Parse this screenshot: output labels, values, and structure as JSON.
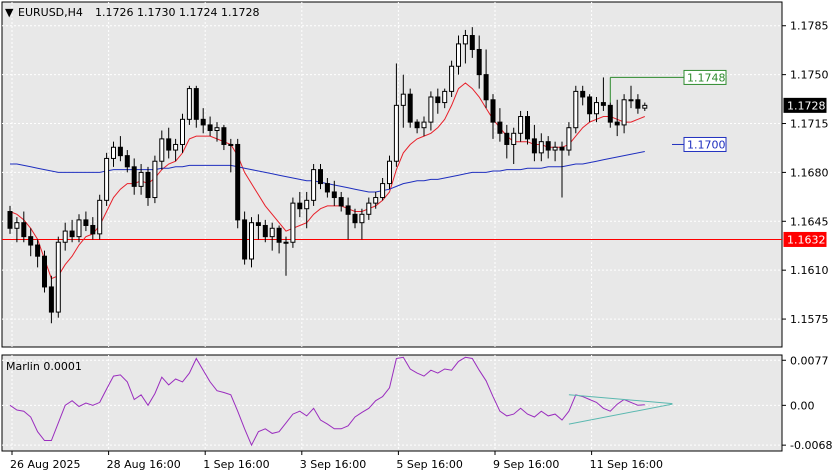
{
  "header": {
    "symbol": "EURUSD,H4",
    "ohlc": "1.1726 1.1730 1.1724 1.1728"
  },
  "colors": {
    "background": "#e8e8e8",
    "grid": "#ffffff",
    "candle_up_fill": "#ffffff",
    "candle_down_fill": "#000000",
    "candle_outline": "#000000",
    "ma_fast": "#e8202a",
    "ma_slow": "#1f2fbf",
    "support_line": "#ff0000",
    "label_green": "#2e8b2e",
    "label_blue": "#1f2fbf",
    "oscillator": "#9a2dbe",
    "trendline": "#5bb8b0"
  },
  "chart_data": [
    {
      "type": "candlestick",
      "title": "EURUSD,H4",
      "ylim": [
        1.1555,
        1.1802
      ],
      "y_ticks": [
        "1.1785",
        "1.1750",
        "1.1715",
        "1.1680",
        "1.1645",
        "1.1610",
        "1.1575"
      ],
      "x_ticks": [
        "26 Aug 2025",
        "28 Aug 16:00",
        "1 Sep 16:00",
        "3 Sep 16:00",
        "5 Sep 16:00",
        "9 Sep 16:00",
        "11 Sep 16:00"
      ],
      "grid": true,
      "ohlc": [
        [
          1.1652,
          1.1656,
          1.1636,
          1.164
        ],
        [
          1.164,
          1.1648,
          1.163,
          1.1644
        ],
        [
          1.1644,
          1.1652,
          1.163,
          1.1634
        ],
        [
          1.1634,
          1.164,
          1.162,
          1.1628
        ],
        [
          1.1628,
          1.1632,
          1.1612,
          1.162
        ],
        [
          1.162,
          1.1624,
          1.1594,
          1.1598
        ],
        [
          1.1598,
          1.1606,
          1.1572,
          1.158
        ],
        [
          1.158,
          1.1634,
          1.1576,
          1.163
        ],
        [
          1.163,
          1.1644,
          1.1624,
          1.1638
        ],
        [
          1.1638,
          1.1646,
          1.163,
          1.1634
        ],
        [
          1.1634,
          1.165,
          1.163,
          1.1646
        ],
        [
          1.1646,
          1.1652,
          1.1638,
          1.1642
        ],
        [
          1.1642,
          1.1648,
          1.1632,
          1.1636
        ],
        [
          1.1636,
          1.1664,
          1.1632,
          1.166
        ],
        [
          1.166,
          1.1694,
          1.1656,
          1.169
        ],
        [
          1.169,
          1.1702,
          1.1684,
          1.1698
        ],
        [
          1.1698,
          1.1706,
          1.1688,
          1.1692
        ],
        [
          1.1692,
          1.1696,
          1.168,
          1.1684
        ],
        [
          1.1684,
          1.169,
          1.1664,
          1.167
        ],
        [
          1.167,
          1.1686,
          1.1664,
          1.168
        ],
        [
          1.168,
          1.1684,
          1.1656,
          1.1662
        ],
        [
          1.1662,
          1.1692,
          1.1658,
          1.1688
        ],
        [
          1.1688,
          1.171,
          1.1682,
          1.1704
        ],
        [
          1.1704,
          1.1712,
          1.169,
          1.1696
        ],
        [
          1.1696,
          1.1704,
          1.1688,
          1.17
        ],
        [
          1.17,
          1.1722,
          1.1694,
          1.1718
        ],
        [
          1.1718,
          1.1742,
          1.1714,
          1.174
        ],
        [
          1.174,
          1.1742,
          1.1712,
          1.1718
        ],
        [
          1.1718,
          1.1726,
          1.1708,
          1.1714
        ],
        [
          1.1714,
          1.172,
          1.1706,
          1.171
        ],
        [
          1.171,
          1.1716,
          1.1702,
          1.1712
        ],
        [
          1.1712,
          1.1714,
          1.1696,
          1.17
        ],
        [
          1.17,
          1.1704,
          1.168,
          1.17
        ],
        [
          1.17,
          1.1704,
          1.164,
          1.1646
        ],
        [
          1.1646,
          1.1652,
          1.1614,
          1.1618
        ],
        [
          1.1618,
          1.1648,
          1.1612,
          1.1644
        ],
        [
          1.1644,
          1.165,
          1.1632,
          1.1642
        ],
        [
          1.1642,
          1.1646,
          1.163,
          1.1634
        ],
        [
          1.1634,
          1.1644,
          1.1624,
          1.164
        ],
        [
          1.164,
          1.1642,
          1.1622,
          1.163
        ],
        [
          1.163,
          1.1634,
          1.1606,
          1.163
        ],
        [
          1.163,
          1.1662,
          1.1626,
          1.1658
        ],
        [
          1.1658,
          1.1666,
          1.1648,
          1.1654
        ],
        [
          1.1654,
          1.1666,
          1.164,
          1.166
        ],
        [
          1.166,
          1.1686,
          1.1656,
          1.1682
        ],
        [
          1.1682,
          1.1686,
          1.1668,
          1.1672
        ],
        [
          1.1672,
          1.1676,
          1.1662,
          1.1666
        ],
        [
          1.1666,
          1.1674,
          1.1656,
          1.1662
        ],
        [
          1.1662,
          1.1666,
          1.1652,
          1.1656
        ],
        [
          1.1656,
          1.1662,
          1.1632,
          1.165
        ],
        [
          1.165,
          1.1654,
          1.164,
          1.1644
        ],
        [
          1.1644,
          1.1654,
          1.1632,
          1.165
        ],
        [
          1.165,
          1.1662,
          1.1646,
          1.1658
        ],
        [
          1.1658,
          1.1666,
          1.1654,
          1.1662
        ],
        [
          1.1662,
          1.1676,
          1.166,
          1.1672
        ],
        [
          1.1672,
          1.1692,
          1.1668,
          1.1688
        ],
        [
          1.1688,
          1.1758,
          1.1684,
          1.1728
        ],
        [
          1.1728,
          1.175,
          1.1712,
          1.1736
        ],
        [
          1.1736,
          1.174,
          1.1712,
          1.1716
        ],
        [
          1.1716,
          1.1718,
          1.1708,
          1.1712
        ],
        [
          1.1712,
          1.172,
          1.1706,
          1.1716
        ],
        [
          1.1716,
          1.1738,
          1.171,
          1.1734
        ],
        [
          1.1734,
          1.174,
          1.1722,
          1.173
        ],
        [
          1.173,
          1.174,
          1.1726,
          1.1738
        ],
        [
          1.1738,
          1.176,
          1.1734,
          1.1756
        ],
        [
          1.1756,
          1.1778,
          1.175,
          1.1772
        ],
        [
          1.1772,
          1.1782,
          1.1758,
          1.1778
        ],
        [
          1.1778,
          1.1784,
          1.1762,
          1.1768
        ],
        [
          1.1768,
          1.1778,
          1.174,
          1.175
        ],
        [
          1.175,
          1.1768,
          1.1726,
          1.1732
        ],
        [
          1.1732,
          1.1736,
          1.1704,
          1.1716
        ],
        [
          1.1716,
          1.1726,
          1.1702,
          1.1708
        ],
        [
          1.1708,
          1.1714,
          1.169,
          1.17
        ],
        [
          1.17,
          1.1712,
          1.1686,
          1.1708
        ],
        [
          1.1708,
          1.1724,
          1.1702,
          1.172
        ],
        [
          1.172,
          1.1724,
          1.17,
          1.1704
        ],
        [
          1.1704,
          1.1714,
          1.1688,
          1.1694
        ],
        [
          1.1694,
          1.1708,
          1.1688,
          1.1702
        ],
        [
          1.1702,
          1.1706,
          1.169,
          1.1696
        ],
        [
          1.1696,
          1.1702,
          1.1688,
          1.1698
        ],
        [
          1.1698,
          1.1702,
          1.1662,
          1.1696
        ],
        [
          1.1696,
          1.1716,
          1.1692,
          1.1712
        ],
        [
          1.1712,
          1.1742,
          1.1708,
          1.1738
        ],
        [
          1.1738,
          1.1742,
          1.1728,
          1.1734
        ],
        [
          1.1734,
          1.1736,
          1.1716,
          1.1722
        ],
        [
          1.1722,
          1.1734,
          1.1716,
          1.173
        ],
        [
          1.173,
          1.1748,
          1.1724,
          1.1728
        ],
        [
          1.1728,
          1.173,
          1.1712,
          1.1716
        ],
        [
          1.1716,
          1.1732,
          1.1706,
          1.1714
        ],
        [
          1.1714,
          1.1736,
          1.1708,
          1.1732
        ],
        [
          1.1732,
          1.1742,
          1.1726,
          1.1732
        ],
        [
          1.1732,
          1.1736,
          1.1722,
          1.1726
        ],
        [
          1.1726,
          1.173,
          1.1724,
          1.1728
        ]
      ],
      "series": [
        {
          "kind": "ma_fast",
          "values": [
            1.1652,
            1.165,
            1.1646,
            1.164,
            1.1632,
            1.1618,
            1.1604,
            1.1606,
            1.1614,
            1.162,
            1.1628,
            1.1634,
            1.1636,
            1.1642,
            1.1652,
            1.1662,
            1.1668,
            1.1672,
            1.1672,
            1.1674,
            1.1672,
            1.1676,
            1.1682,
            1.1686,
            1.1688,
            1.1694,
            1.1704,
            1.1706,
            1.1706,
            1.1706,
            1.1704,
            1.1702,
            1.17,
            1.1692,
            1.168,
            1.1672,
            1.1664,
            1.1656,
            1.165,
            1.1644,
            1.1638,
            1.164,
            1.1642,
            1.1644,
            1.165,
            1.1654,
            1.1656,
            1.1656,
            1.1656,
            1.1654,
            1.1652,
            1.1652,
            1.1654,
            1.1656,
            1.166,
            1.1666,
            1.1682,
            1.1694,
            1.17,
            1.1704,
            1.1706,
            1.1708,
            1.1712,
            1.1718,
            1.1728,
            1.174,
            1.1744,
            1.174,
            1.1734,
            1.1726,
            1.1718,
            1.1712,
            1.1706,
            1.1702,
            1.1702,
            1.1702,
            1.17,
            1.17,
            1.1698,
            1.1698,
            1.1698,
            1.17,
            1.1706,
            1.1712,
            1.1716,
            1.1718,
            1.172,
            1.172,
            1.1718,
            1.1716,
            1.1716,
            1.1718,
            1.172
          ]
        },
        {
          "kind": "ma_slow",
          "values": [
            1.1686,
            1.1686,
            1.1685,
            1.1684,
            1.1683,
            1.1682,
            1.1681,
            1.168,
            1.168,
            1.168,
            1.168,
            1.168,
            1.168,
            1.168,
            1.1681,
            1.1682,
            1.1682,
            1.1682,
            1.1682,
            1.1682,
            1.1682,
            1.1682,
            1.1683,
            1.1683,
            1.1684,
            1.1684,
            1.1685,
            1.1685,
            1.1685,
            1.1685,
            1.1685,
            1.1685,
            1.1685,
            1.1684,
            1.1683,
            1.1682,
            1.1681,
            1.168,
            1.1679,
            1.1678,
            1.1677,
            1.1676,
            1.1675,
            1.1674,
            1.1674,
            1.1673,
            1.1672,
            1.1671,
            1.167,
            1.1669,
            1.1668,
            1.1667,
            1.1666,
            1.1666,
            1.1667,
            1.1668,
            1.167,
            1.1672,
            1.1673,
            1.1674,
            1.1674,
            1.1675,
            1.1675,
            1.1676,
            1.1677,
            1.1678,
            1.1679,
            1.168,
            1.168,
            1.168,
            1.1681,
            1.1681,
            1.1682,
            1.1682,
            1.1682,
            1.1683,
            1.1683,
            1.1683,
            1.1684,
            1.1684,
            1.1684,
            1.1685,
            1.1686,
            1.1686,
            1.1687,
            1.1688,
            1.1689,
            1.169,
            1.1691,
            1.1692,
            1.1693,
            1.1694,
            1.1695
          ]
        }
      ],
      "price_labels": [
        {
          "value": 1.1748,
          "text": "1.1748",
          "style": "green"
        },
        {
          "value": 1.1728,
          "text": "1.1728",
          "style": "current"
        },
        {
          "value": 1.17,
          "text": "1.1700",
          "style": "blue"
        },
        {
          "value": 1.1632,
          "text": "1.1632",
          "style": "red"
        }
      ],
      "horizontal_line": 1.1632,
      "green_line": {
        "from_index": 87,
        "value": 1.1748
      }
    },
    {
      "type": "line",
      "title": "Marlin 0.0001",
      "ylim": [
        -0.0078,
        0.0086
      ],
      "y_ticks": [
        "0.0077",
        "0.00",
        "-0.0068"
      ],
      "values": [
        0.0,
        -0.0008,
        -0.001,
        -0.002,
        -0.0045,
        -0.006,
        -0.006,
        -0.003,
        0.0,
        0.0008,
        -0.0002,
        0.0004,
        0.0,
        0.0005,
        0.0028,
        0.005,
        0.0052,
        0.004,
        0.001,
        0.0018,
        0.0,
        0.002,
        0.0048,
        0.0035,
        0.0045,
        0.004,
        0.0055,
        0.008,
        0.006,
        0.004,
        0.0025,
        0.0022,
        0.0018,
        -0.001,
        -0.004,
        -0.0068,
        -0.0045,
        -0.004,
        -0.0048,
        -0.0045,
        -0.003,
        -0.0015,
        -0.001,
        -0.0018,
        -0.0005,
        -0.0025,
        -0.0032,
        -0.004,
        -0.004,
        -0.0035,
        -0.002,
        -0.0012,
        -0.0005,
        0.0008,
        0.0015,
        0.003,
        0.008,
        0.0082,
        0.0062,
        0.0055,
        0.005,
        0.006,
        0.0055,
        0.0062,
        0.006,
        0.0075,
        0.0082,
        0.008,
        0.006,
        0.0042,
        0.0015,
        -0.001,
        -0.0018,
        -0.0015,
        -0.0005,
        -0.0015,
        -0.002,
        -0.001,
        -0.0018,
        -0.0015,
        -0.0025,
        -0.001,
        0.0018,
        0.0015,
        0.001,
        0.0005,
        -0.0005,
        -0.001,
        0.0002,
        0.001,
        0.0005,
        0.0,
        0.0001
      ],
      "trendlines": [
        {
          "from_index": 81,
          "to_index": 96,
          "from_value": 0.0018,
          "to_value": 0.0003
        },
        {
          "from_index": 81,
          "to_index": 96,
          "from_value": -0.0032,
          "to_value": 0.0002
        }
      ]
    }
  ]
}
